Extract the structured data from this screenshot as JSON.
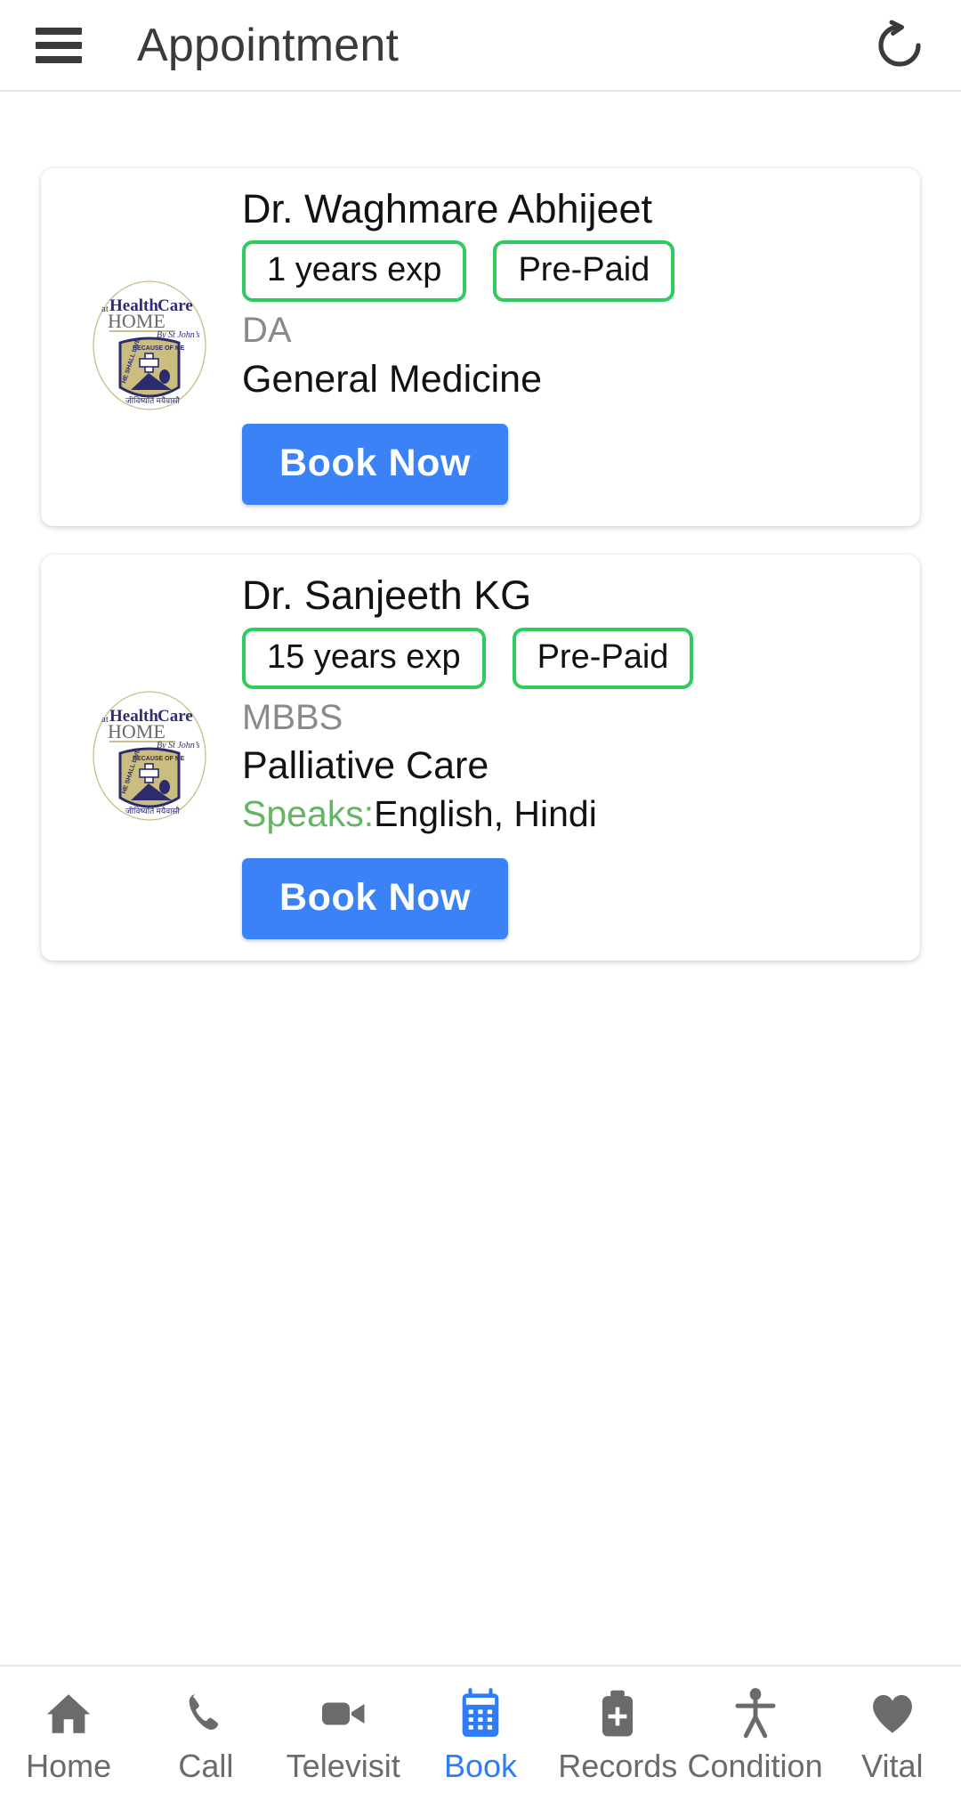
{
  "appbar": {
    "menu_icon": "hamburger-menu-icon",
    "title": "Appointment",
    "refresh_icon": "refresh-icon"
  },
  "colors": {
    "accent_blue": "#3b82f6",
    "badge_green": "#2ecc5e",
    "speaks_green": "#62b662",
    "muted_text": "#8a8a8a",
    "nav_inactive": "#6b6b6b",
    "nav_active": "#2f7df6"
  },
  "logo": {
    "at": "at",
    "health": "Health",
    "care": "Care",
    "home": "HOME",
    "by": "By St John’s",
    "crest_top": "BECAUSE OF ME",
    "crest_left": "HE SHALL LIVE",
    "crest_bottom": "जीविष्यति मयैवासौ"
  },
  "appointments": [
    {
      "name": "Dr. Waghmare Abhijeet",
      "experience": "1 years exp",
      "payment": "Pre-Paid",
      "qualification": "DA",
      "speciality": "General Medicine",
      "speaks_label": "",
      "speaks_value": "",
      "book_label": "Book Now"
    },
    {
      "name": "Dr. Sanjeeth KG",
      "experience": "15 years exp",
      "payment": "Pre-Paid",
      "qualification": "MBBS",
      "speciality": "Palliative Care",
      "speaks_label": "Speaks:",
      "speaks_value": "English, Hindi",
      "book_label": "Book Now"
    }
  ],
  "bottom_nav": {
    "active_index": 3,
    "items": [
      {
        "label": "Home",
        "icon": "home-icon"
      },
      {
        "label": "Call",
        "icon": "phone-icon"
      },
      {
        "label": "Televisit",
        "icon": "video-camera-icon"
      },
      {
        "label": "Book",
        "icon": "calendar-icon"
      },
      {
        "label": "Records",
        "icon": "briefcase-plus-icon"
      },
      {
        "label": "Condition",
        "icon": "person-icon"
      },
      {
        "label": "Vital",
        "icon": "heart-icon"
      }
    ]
  }
}
